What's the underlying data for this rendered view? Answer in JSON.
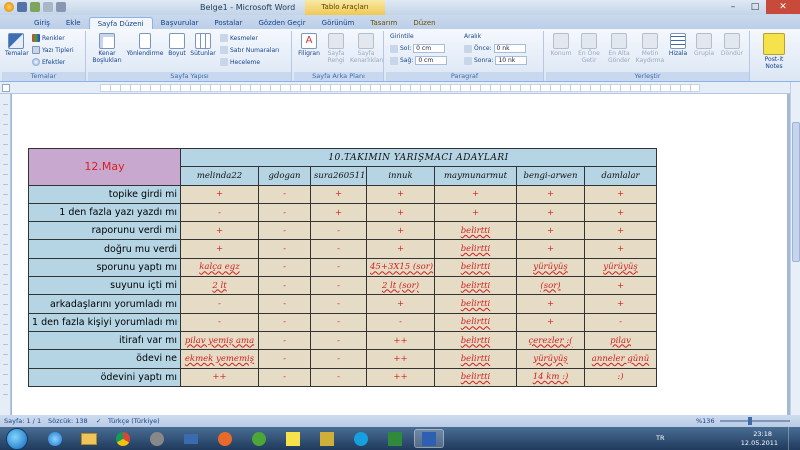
{
  "window": {
    "title": "Belge1 - Microsoft Word",
    "tool_tab_title": "Tablo Araçları",
    "controls": [
      "–",
      "□",
      "✕"
    ]
  },
  "tabs": [
    "Giriş",
    "Ekle",
    "Sayfa Düzeni",
    "Başvurular",
    "Postalar",
    "Gözden Geçir",
    "Görünüm",
    "Tasarım",
    "Düzen"
  ],
  "ribbon": {
    "temalar": {
      "button": "Temalar",
      "renkler": "Renkler",
      "yazi_tipleri": "Yazı Tipleri",
      "efektler": "Efektler",
      "label": "Temalar"
    },
    "sayfa_yapisi": {
      "kenar": "Kenar Boşlukları",
      "yonlendirme": "Yönlendirme",
      "boyut": "Boyut",
      "sutunlar": "Sütunlar",
      "kesmeler": "Kesmeler",
      "satir_numaralari": "Satır Numaraları",
      "heceleme": "Heceleme",
      "label": "Sayfa Yapısı"
    },
    "sayfa_arka_plani": {
      "filigran": "Filigran",
      "sayfa_rengi": "Sayfa Rengi",
      "sayfa_kenarlik": "Sayfa Kenarlıkları",
      "label": "Sayfa Arka Planı"
    },
    "paragraf": {
      "girintile": "Girintile",
      "sol_label": "Sol:",
      "sol_value": "0 cm",
      "sag_label": "Sağ:",
      "sag_value": "0 cm",
      "aralik": "Aralık",
      "once_label": "Önce:",
      "once_value": "0 nk",
      "sonra_label": "Sonra:",
      "sonra_value": "10 nk",
      "label": "Paragraf"
    },
    "yerlestir": {
      "buttons": [
        "Konum",
        "En Öne Getir",
        "En Alta Gönder",
        "Metin Kaydırma",
        "Hizala",
        "Grupla",
        "Döndür"
      ],
      "label": "Yerleştir"
    },
    "postit": "Post-it Notes"
  },
  "table": {
    "date": "12.May",
    "title": "10.TAKIMIN YARIŞMACI ADAYLARI",
    "columns": [
      "melinda22",
      "gdogan",
      "sura260511",
      "innuk",
      "maymunarmut",
      "bengi-arwen",
      "damlalar"
    ],
    "rows": [
      {
        "q": "topike girdi mi",
        "cells": [
          "+",
          "-",
          "+",
          "+",
          "+",
          "+",
          "+"
        ]
      },
      {
        "q": "1 den fazla yazı yazdı mı",
        "cells": [
          "-",
          "-",
          "+",
          "+",
          "+",
          "+",
          "+"
        ]
      },
      {
        "q": "raporunu verdi mi",
        "cells": [
          "+",
          "-",
          "-",
          "+",
          "belirtti",
          "+",
          "+"
        ]
      },
      {
        "q": "doğru mu verdi",
        "cells": [
          "+",
          "-",
          "-",
          "+",
          "belirtti",
          "+",
          "+"
        ]
      },
      {
        "q": "sporunu yaptı mı",
        "cells": [
          "kalça egz",
          "-",
          "-",
          "45+3X15 (sor)",
          "belirtti",
          "yürüyüş",
          "yürüyüş"
        ]
      },
      {
        "q": "suyunu içti mi",
        "cells": [
          "2 lt",
          "-",
          "-",
          "2 lt (sor)",
          "belirtti",
          "(sor)",
          "+"
        ]
      },
      {
        "q": "arkadaşlarını yorumladı mı",
        "cells": [
          "-",
          "-",
          "-",
          "+",
          "belirtti",
          "+",
          "+"
        ]
      },
      {
        "q": "1 den fazla kişiyi yorumladı mı",
        "cells": [
          "-",
          "-",
          "-",
          "-",
          "belirtti",
          "+",
          "-"
        ]
      },
      {
        "q": "itirafı var mı",
        "cells": [
          "pilav yemiş ama",
          "-",
          "-",
          "++",
          "belirtti",
          "çerezler :(",
          "pilav"
        ]
      },
      {
        "q": "ödevi ne",
        "cells": [
          "ekmek yememiş",
          "-",
          "-",
          "++",
          "belirtti",
          "yürüyüş",
          "anneler günü"
        ]
      },
      {
        "q": "ödevini yaptı mı",
        "cells": [
          "++",
          "-",
          "-",
          "++",
          "belirtti",
          "14 km :)",
          ":)"
        ]
      }
    ]
  },
  "statusbar": {
    "page": "Sayfa: 1 / 1",
    "words": "Sözcük: 138",
    "language": "Türkçe (Türkiye)",
    "zoom": "%136"
  },
  "taskbar": {
    "lang": "TR",
    "time": "23:18",
    "date": "12.05.2011"
  }
}
